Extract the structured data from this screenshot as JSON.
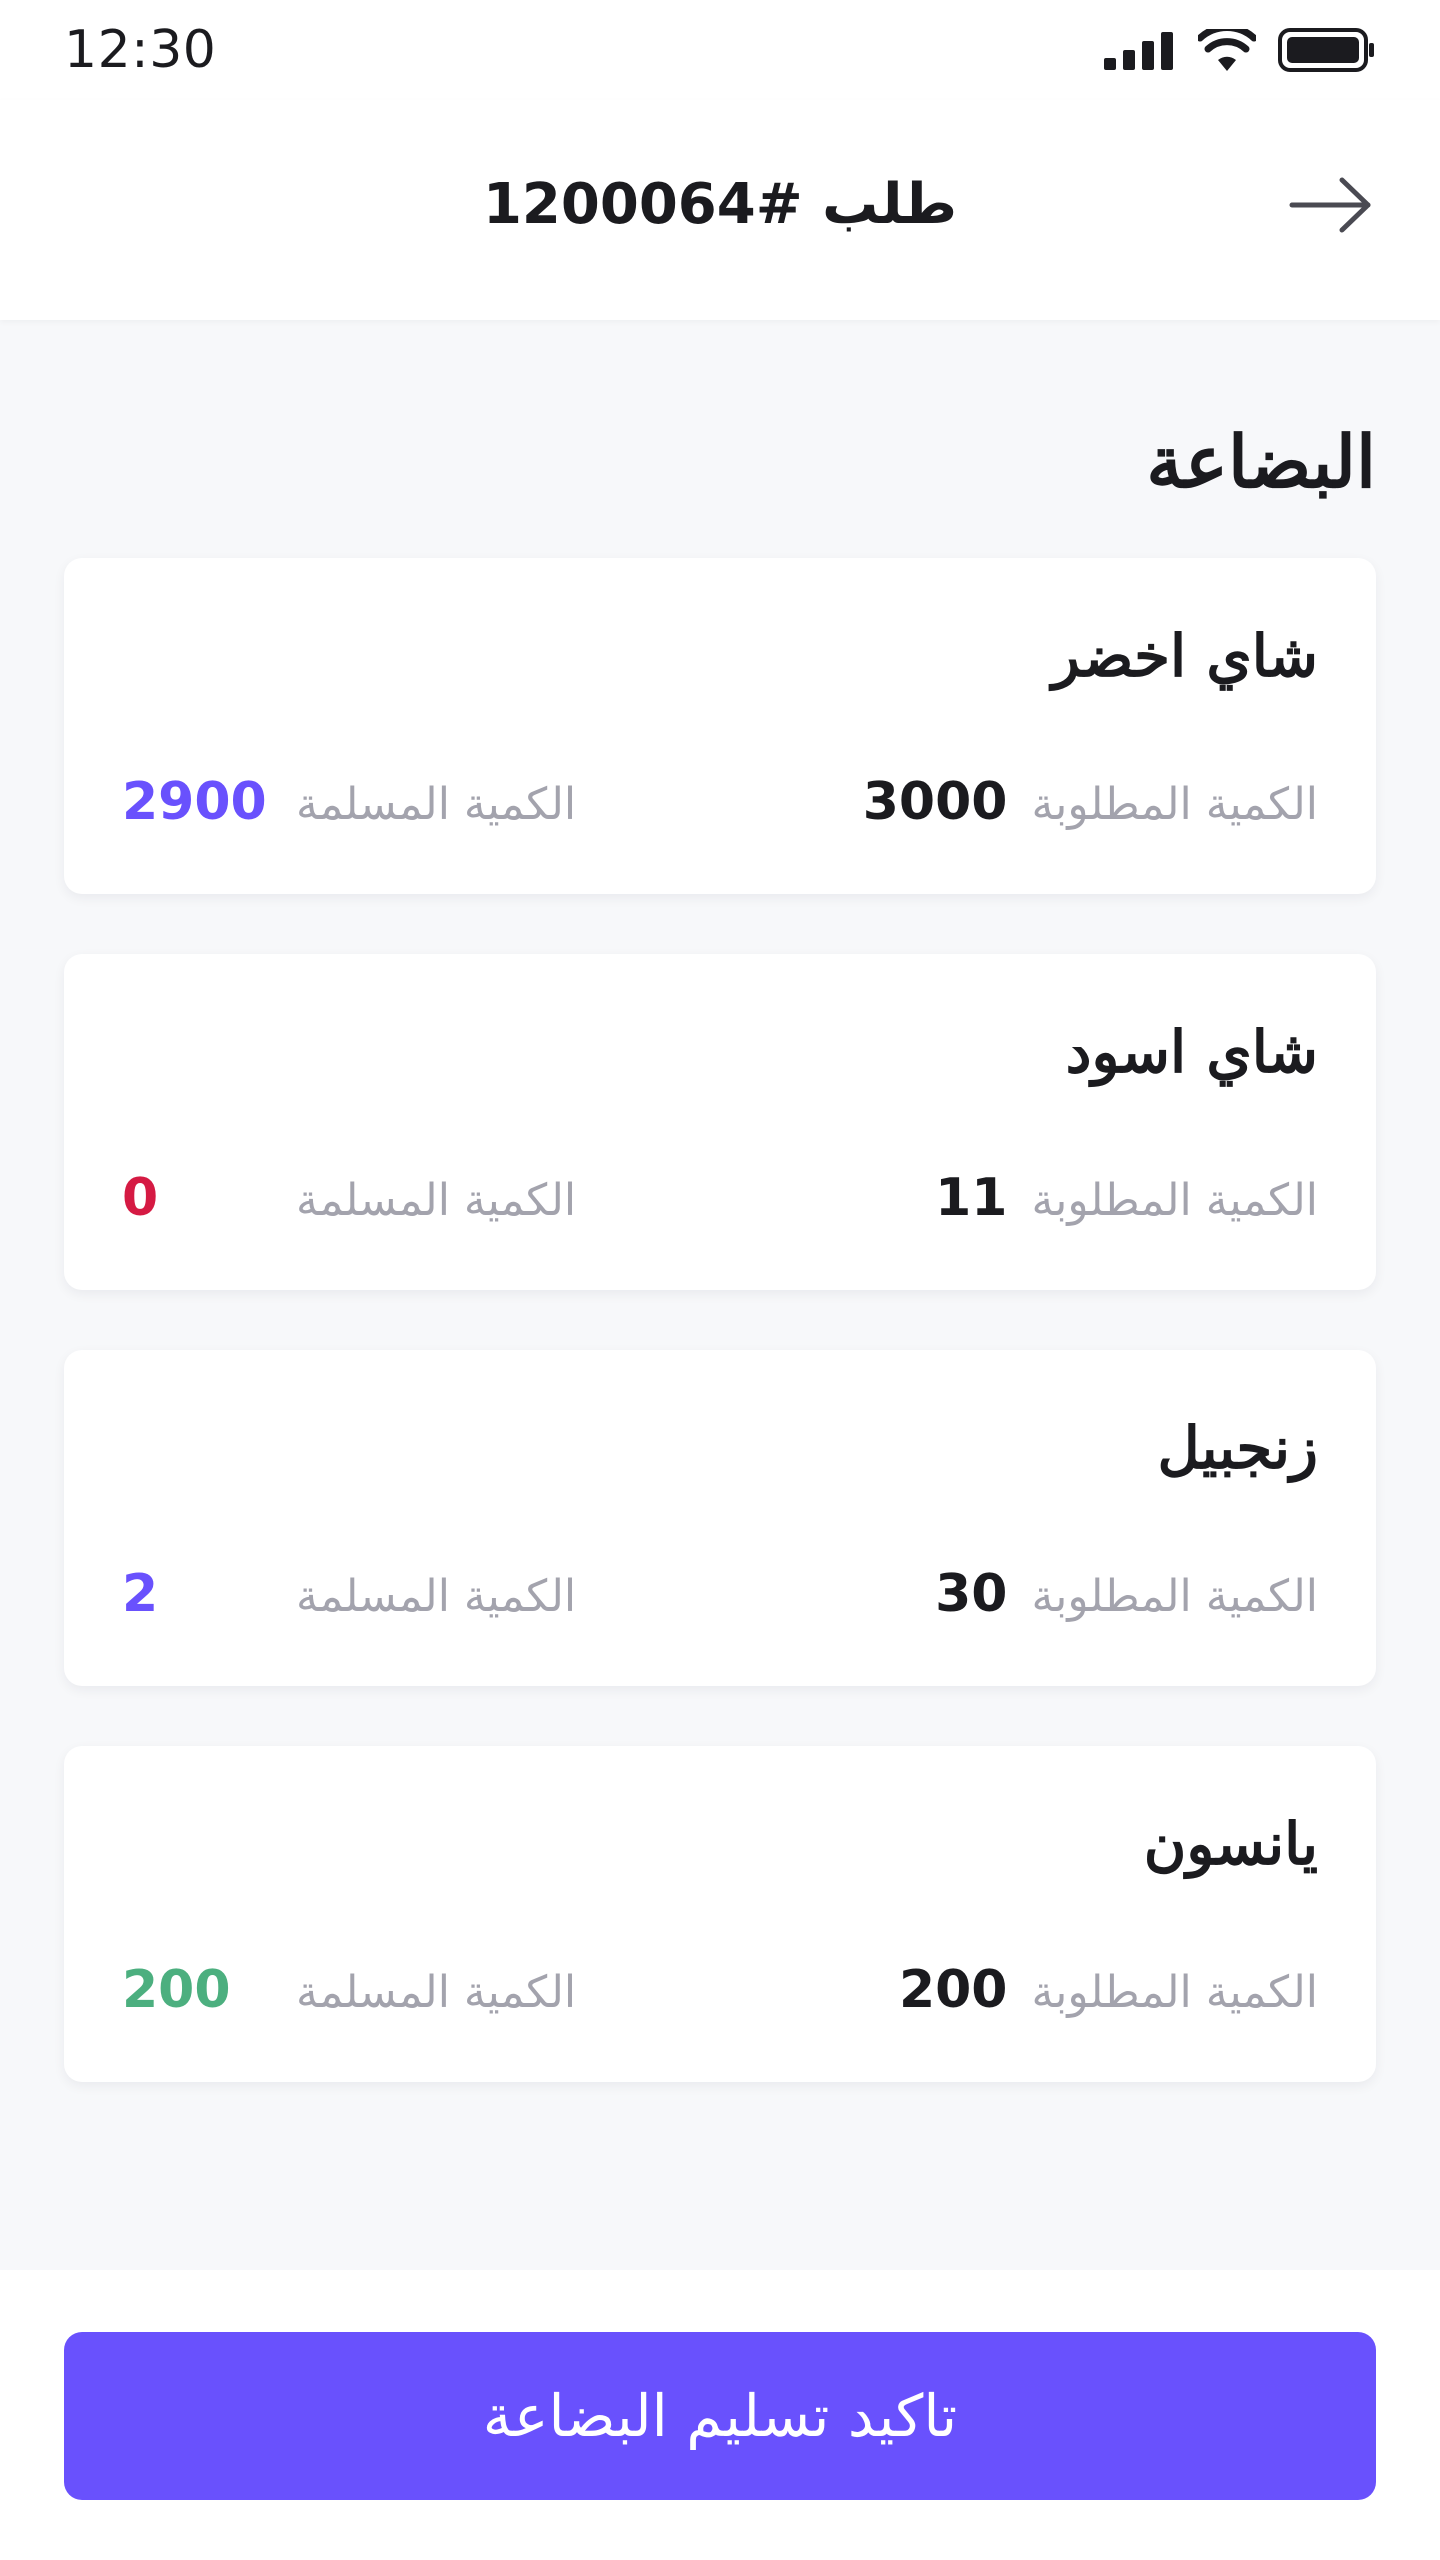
{
  "status_bar": {
    "time": "12:30",
    "icons": [
      "signal-icon",
      "wifi-icon",
      "battery-icon"
    ]
  },
  "header": {
    "title": "طلب #1200064",
    "back_icon": "arrow-right-icon"
  },
  "section": {
    "title": "البضاعة"
  },
  "labels": {
    "required": "الكمية المطلوبة",
    "delivered": "الكمية المسلمة"
  },
  "items": [
    {
      "name": "شاي اخضر",
      "required": "3000",
      "delivered": "2900",
      "delivered_color": "#6951fd"
    },
    {
      "name": "شاي اسود",
      "required": "11",
      "delivered": "0",
      "delivered_color": "#d51a43"
    },
    {
      "name": "زنجبيل",
      "required": "30",
      "delivered": "2",
      "delivered_color": "#6951fd"
    },
    {
      "name": "يانسون",
      "required": "200",
      "delivered": "200",
      "delivered_color": "#4caf7f"
    }
  ],
  "footer": {
    "confirm_label": "تاكيد تسليم البضاعة"
  },
  "colors": {
    "accent": "#6951fd",
    "error": "#d51a43",
    "success": "#4caf7f",
    "muted_label": "#a3a3ad"
  }
}
